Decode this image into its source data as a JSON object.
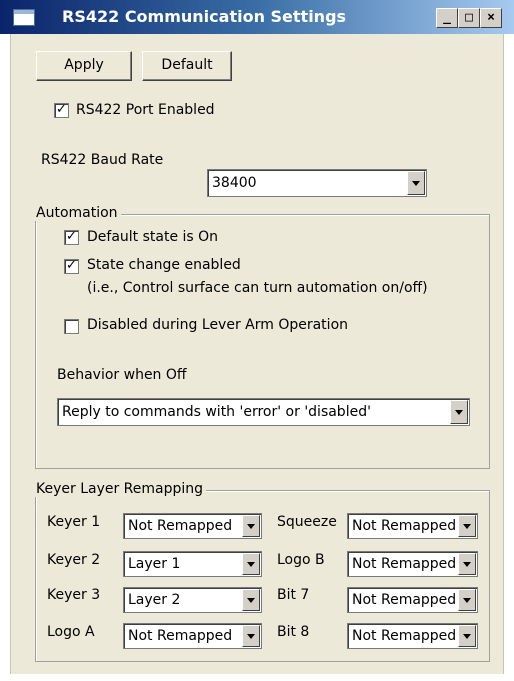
{
  "window": {
    "title": "RS422 Communication Settings",
    "minimize": "_",
    "maximize": "□",
    "close": "×"
  },
  "toolbar": {
    "apply": "Apply",
    "default": "Default"
  },
  "port": {
    "enabled_label": "RS422 Port Enabled",
    "enabled": true,
    "baud_label": "RS422 Baud Rate",
    "baud_value": "38400"
  },
  "automation": {
    "legend": "Automation",
    "default_on_label": "Default state is On",
    "default_on": true,
    "state_change_label": "State change enabled",
    "state_change_note": "(i.e., Control surface can turn automation on/off)",
    "state_change": true,
    "disabled_lever_label": "Disabled during Lever Arm Operation",
    "disabled_lever": false,
    "behavior_label": "Behavior when Off",
    "behavior_value": "Reply to commands with 'error' or 'disabled'"
  },
  "keyer": {
    "legend": "Keyer Layer Remapping",
    "left": [
      {
        "label": "Keyer 1",
        "value": "Not Remapped"
      },
      {
        "label": "Keyer 2",
        "value": "Layer 1"
      },
      {
        "label": "Keyer 3",
        "value": "Layer 2"
      },
      {
        "label": "Logo A",
        "value": "Not Remapped"
      }
    ],
    "right": [
      {
        "label": "Squeeze",
        "value": "Not Remapped"
      },
      {
        "label": "Logo B",
        "value": "Not Remapped"
      },
      {
        "label": "Bit 7",
        "value": "Not Remapped"
      },
      {
        "label": "Bit 8",
        "value": "Not Remapped"
      }
    ]
  },
  "colors": {
    "title_start": "#0a246a",
    "title_end": "#a6caf0",
    "face": "#ece9d8"
  }
}
